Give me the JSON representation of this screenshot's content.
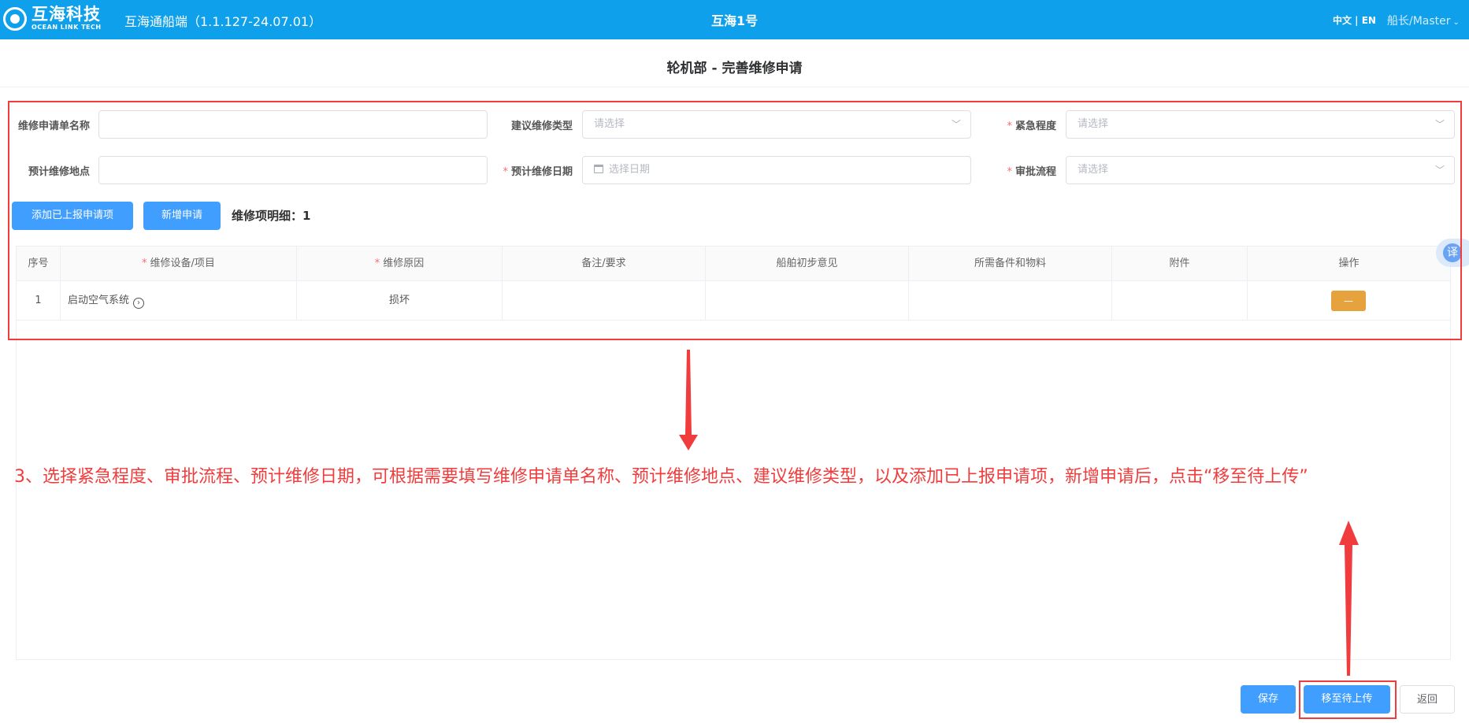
{
  "header": {
    "logo_cn": "互海科技",
    "logo_en": "OCEAN LINK TECH",
    "app_title": "互海通船端（1.1.127-24.07.01）",
    "ship_name": "互海1号",
    "lang_switch": "中文 | EN",
    "user": "船长/Master"
  },
  "page_title": "轮机部 - 完善维修申请",
  "form": {
    "name_label": "维修申请单名称",
    "name_value": "",
    "type_label": "建议维修类型",
    "type_placeholder": "请选择",
    "urgency_label": "紧急程度",
    "urgency_placeholder": "请选择",
    "location_label": "预计维修地点",
    "location_value": "",
    "date_label": "预计维修日期",
    "date_placeholder": "选择日期",
    "approval_label": "审批流程",
    "approval_placeholder": "请选择",
    "required_mark": "*"
  },
  "actions": {
    "add_reported": "添加已上报申请项",
    "new_request": "新增申请",
    "detail_label": "维修项明细：1"
  },
  "table": {
    "columns": [
      "序号",
      "维修设备/项目",
      "维修原因",
      "备注/要求",
      "船舶初步意见",
      "所需备件和物料",
      "附件",
      "操作"
    ],
    "rows": [
      {
        "index": "1",
        "equipment": "启动空气系统",
        "reason": "损坏",
        "remark": "",
        "opinion": "",
        "parts": "",
        "attachment": "",
        "op_button": "—"
      }
    ]
  },
  "annotation": "3、选择紧急程度、审批流程、预计维修日期，可根据需要填写维修申请单名称、预计维修地点、建议维修类型，以及添加已上报申请项，新增申请后，点击“移至待上传”",
  "translate_fab": "译",
  "footer": {
    "save": "保存",
    "move_to_upload": "移至待上传",
    "back": "返回"
  },
  "colors": {
    "header_bg": "#0ea0ea",
    "primary": "#409eff",
    "warning": "#e6a23c",
    "annotation": "#f03c3c"
  }
}
